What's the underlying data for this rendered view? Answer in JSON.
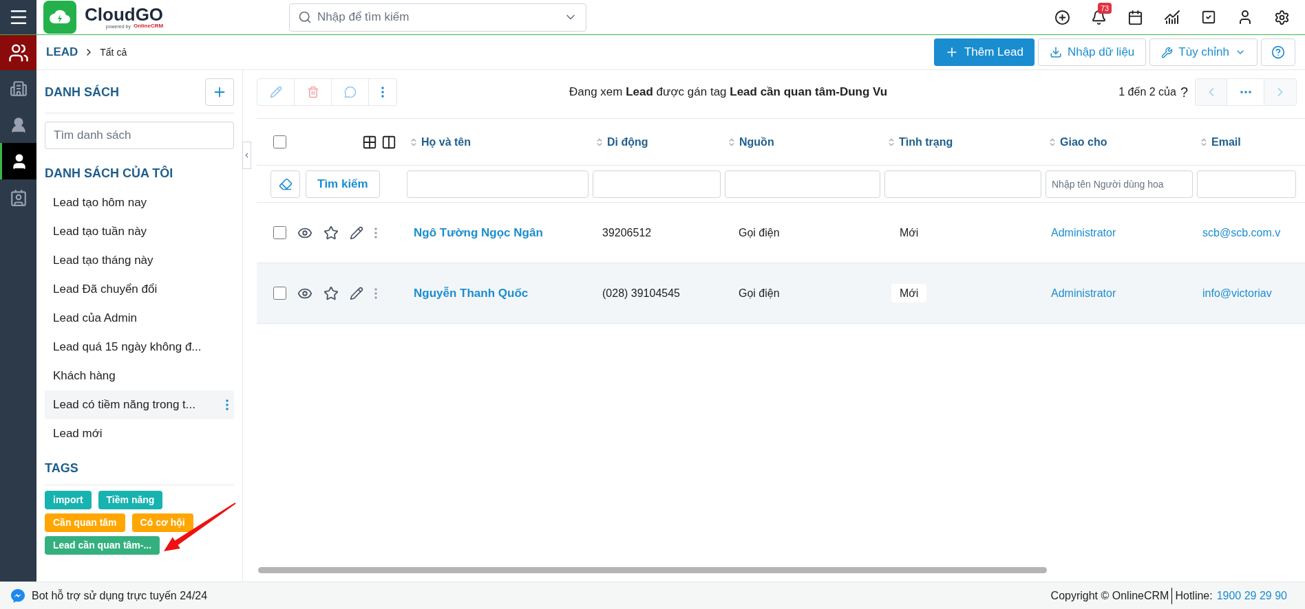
{
  "topbar": {
    "logo_name": "CloudGO",
    "logo_sub": "powered by",
    "logo_brand": "OnlineCRM",
    "search_placeholder": "Nhập để tìm kiếm",
    "notification_count": "73"
  },
  "rail": [
    {
      "kind": "building",
      "selected": false
    },
    {
      "kind": "agent",
      "selected": false
    },
    {
      "kind": "person",
      "selected": true
    },
    {
      "kind": "contact",
      "selected": false
    }
  ],
  "breadcrumb": {
    "module": "LEAD",
    "current": "Tất cả"
  },
  "actions": [
    {
      "kind": "add",
      "label": "Thêm Lead"
    },
    {
      "kind": "import",
      "label": "Nhập dữ liệu"
    },
    {
      "kind": "menu",
      "label": "Tùy chỉnh"
    },
    {
      "kind": "help"
    }
  ],
  "sidebar": {
    "title": "DANH SÁCH",
    "search_placeholder": "Tìm danh sách",
    "my_lists_title": "DANH SÁCH CỦA TÔI",
    "lists": [
      {
        "label": "Lead tạo hôm nay",
        "selected": false
      },
      {
        "label": "Lead tạo tuần này",
        "selected": false
      },
      {
        "label": "Lead tạo tháng này",
        "selected": false
      },
      {
        "label": "Lead Đã chuyển đổi",
        "selected": false
      },
      {
        "label": "Lead của Admin",
        "selected": false
      },
      {
        "label": "Lead quá 15 ngày không đ...",
        "selected": false
      },
      {
        "label": "Khách hàng",
        "selected": false
      },
      {
        "label": "Lead có tiềm năng trong t...",
        "selected": true
      },
      {
        "label": "Lead mới",
        "selected": false
      }
    ],
    "tags_title": "TAGS",
    "tags": [
      {
        "label": "import",
        "color": "#17b3b0"
      },
      {
        "label": "Tiềm năng",
        "color": "#17b3b0"
      },
      {
        "label": "Cần quan tâm",
        "color": "#ffa600"
      },
      {
        "label": "Có cơ hội",
        "color": "#ffa600"
      },
      {
        "label": "Lead cần quan tâm-...",
        "color": "#34b07f"
      }
    ]
  },
  "table": {
    "title": "Đang xem **Lead** được gán tag **Lead cần quan tâm-Dung Vu**",
    "pager": "1 đến 2 của",
    "pager_help": "?",
    "search_button": "Tìm kiếm",
    "select_all": {
      "checked": false
    },
    "columns": [
      {
        "label": "Họ và tên"
      },
      {
        "label": "Di động"
      },
      {
        "label": "Nguồn"
      },
      {
        "label": "Tình trạng"
      },
      {
        "label": "Giao cho",
        "placeholder": "Nhập tên Người dùng hoa"
      },
      {
        "label": "Email"
      }
    ],
    "rows": [
      {
        "name": "Ngô Tường Ngọc Ngân",
        "mobile": "39206512",
        "source": "Gọi điện",
        "status": "Mới",
        "assigned": "Administrator",
        "email": "scb@scb.com.v",
        "highlighted": false,
        "checked": false
      },
      {
        "name": "Nguyễn Thanh Quốc",
        "mobile": "(028) 39104545",
        "source": "Gọi điện",
        "status": "Mới",
        "assigned": "Administrator",
        "email": "info@victoriav",
        "highlighted": true,
        "checked": false
      }
    ]
  },
  "footer": {
    "bot": "Bot hỗ trợ sử dụng trực tuyến 24/24",
    "copyright": "Copyright © OnlineCRM",
    "hotline_label": "Hotline:",
    "hotline": "1900 29 29 90"
  }
}
